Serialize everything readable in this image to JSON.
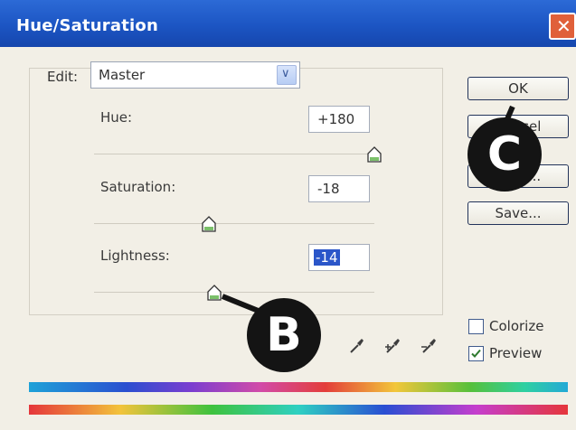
{
  "window": {
    "title": "Hue/Saturation",
    "close_label": "✕"
  },
  "edit": {
    "label": "Edit:",
    "value": "Master"
  },
  "sliders": {
    "hue": {
      "label": "Hue:",
      "value": "+180",
      "level": 1.0
    },
    "saturation": {
      "label": "Saturation:",
      "value": "-18",
      "level": 0.41
    },
    "lightness": {
      "label": "Lightness:",
      "value": "-14",
      "level": 0.43
    }
  },
  "buttons": {
    "ok": "OK",
    "cancel": "Cancel",
    "load": "Load...",
    "save": "Save..."
  },
  "options": {
    "colorize": {
      "label": "Colorize",
      "checked": false
    },
    "preview": {
      "label": "Preview",
      "checked": true
    }
  },
  "callouts": {
    "b": "B",
    "c": "C"
  },
  "icons": {
    "eyedropper": "eyedropper-icon",
    "eyedropper_plus": "eyedropper-plus-icon",
    "eyedropper_minus": "eyedropper-minus-icon"
  }
}
